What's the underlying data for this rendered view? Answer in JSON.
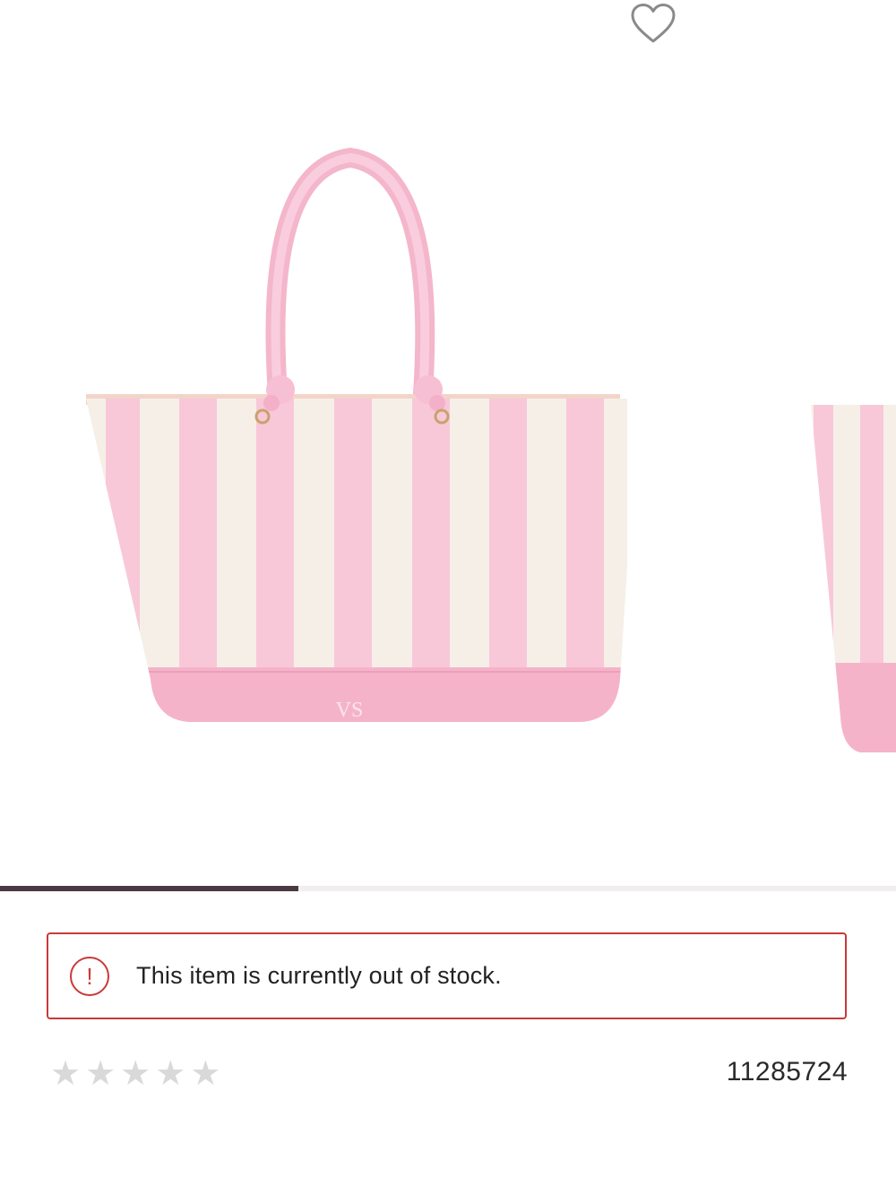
{
  "product": {
    "image_alt": "Pink and white striped canvas tote bag",
    "favorite_icon": "heart-outline-icon",
    "sku": "11285724",
    "rating": 0,
    "max_rating": 5
  },
  "gallery": {
    "progress_fraction": 0.333,
    "colors": {
      "pink": "#f8c8d9",
      "cream": "#f6efe7",
      "base": "#f5b3ca",
      "handle": "#f7bfd3"
    }
  },
  "alert": {
    "icon": "exclamation-circle-icon",
    "icon_glyph": "!",
    "message": "This item is currently out of stock.",
    "color": "#c83a38"
  },
  "stars": [
    "★",
    "★",
    "★",
    "★",
    "★"
  ]
}
